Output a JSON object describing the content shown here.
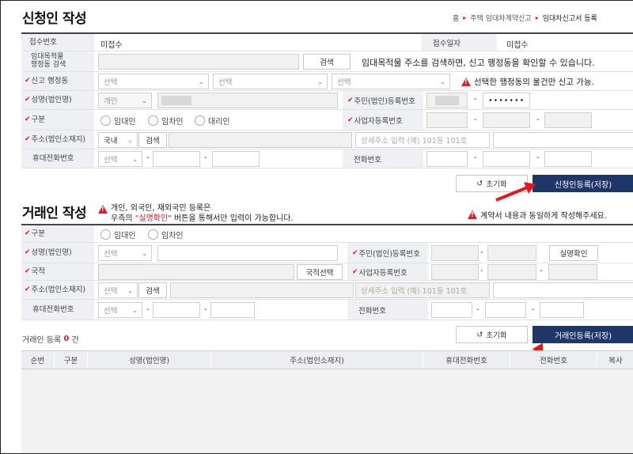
{
  "applicant": {
    "title": "신청인 작성",
    "breadcrumb": [
      "홈",
      "주택 임대차계약신고",
      "임대차신고서 등록"
    ],
    "receipt_no_label": "접수번호",
    "receipt_no_value": "미접수",
    "receipt_date_label": "접수일자",
    "receipt_date_value": "미접수",
    "search_label": "임대목적물\n행정동 검색",
    "search_button": "검색",
    "search_hint": "임대목적물 주소를 검색하면, 신고 행정동을 확인할 수 있습니다.",
    "district_label": "신고 행정동",
    "select_placeholder": "선택",
    "district_warning": "선택한 행정동의 물건만 신고 가능.",
    "name_label": "성명(법인명)",
    "person_type": "개인",
    "resident_no_label": "주민(법인)등록번호",
    "resident_no_masked": "•••••••",
    "type_label": "구분",
    "type_options": [
      "임대인",
      "임차인",
      "대리인"
    ],
    "biz_no_label": "사업자등록번호",
    "address_label": "주소(법인소재지)",
    "domestic": "국내",
    "detail_address_placeholder": "상세주소 입력 (예) 101동 101호",
    "mobile_label": "휴대전화번호",
    "phone_label": "전화번호",
    "reset_button": "초기화",
    "register_button": "신청인등록(저장)"
  },
  "counterparty": {
    "title": "거래인 작성",
    "notice_line1": "개인, 외국인, 재외국민 등록은",
    "notice_line2_pre": "우측의 ",
    "notice_line2_highlight": "\"실명확인\"",
    "notice_line2_post": " 버튼을 통해서만 입력이 가능합니다.",
    "right_notice": "계약서 내용과 동일하게 작성해주세요.",
    "type_label": "구분",
    "type_options": [
      "임대인",
      "임차인"
    ],
    "name_label": "성명(법인명)",
    "select_placeholder": "선택",
    "resident_no_label": "주민(법인)등록번호",
    "verify_button": "실명확인",
    "nationality_label": "국적",
    "nationality_button": "국적선택",
    "biz_no_label": "사업자등록번호",
    "address_label": "주소(법인소재지)",
    "search_button": "검색",
    "detail_address_placeholder": "상세주소 입력 (예) 101동 101호",
    "mobile_label": "휴대전화번호",
    "phone_label": "전화번호",
    "reset_button": "초기화",
    "register_button": "거래인등록(저장)"
  },
  "list": {
    "count_prefix": "거래인 등록",
    "count": "0",
    "count_suffix": "건",
    "columns": [
      "순번",
      "구분",
      "성명(법인명)",
      "주소(법인소재지)",
      "휴대전화번호",
      "전화번호",
      "복사"
    ]
  },
  "colors": {
    "accent_red": "#d7202b",
    "navy": "#1f3768",
    "arrow": "#e8161a"
  },
  "icons": {
    "required": "check-icon",
    "warning": "warning-triangle-icon",
    "reset": "refresh-icon",
    "dropdown": "chevron-down-icon"
  }
}
